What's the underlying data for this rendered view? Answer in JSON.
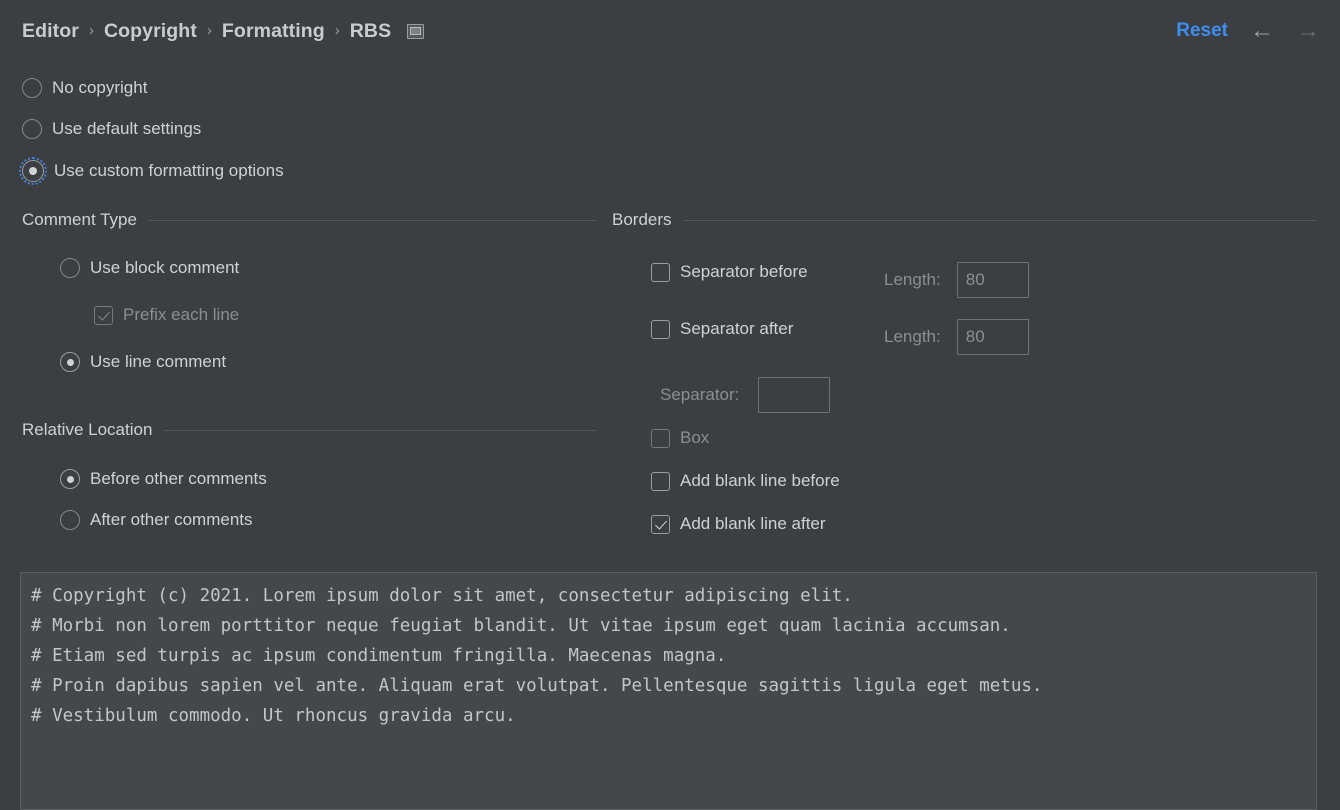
{
  "header": {
    "breadcrumb": [
      "Editor",
      "Copyright",
      "Formatting",
      "RBS"
    ],
    "separator": "›",
    "module_icon": "module-icon",
    "reset_label": "Reset",
    "back_arrow": "←",
    "forward_arrow": "→"
  },
  "top_options": [
    {
      "label": "No copyright",
      "selected": false
    },
    {
      "label": "Use default settings",
      "selected": false
    },
    {
      "label": "Use custom formatting options",
      "selected": true
    }
  ],
  "comment_type": {
    "title": "Comment Type",
    "options": [
      {
        "label": "Use block comment",
        "selected": false
      },
      {
        "label": "Use line comment",
        "selected": true
      }
    ],
    "prefix_each_line": {
      "label": "Prefix each line",
      "checked": true,
      "enabled": false
    }
  },
  "relative_location": {
    "title": "Relative Location",
    "options": [
      {
        "label": "Before other comments",
        "selected": true
      },
      {
        "label": "After other comments",
        "selected": false
      }
    ]
  },
  "borders": {
    "title": "Borders",
    "separator_before": {
      "label": "Separator before",
      "checked": false
    },
    "separator_before_length": {
      "label": "Length:",
      "value": "80"
    },
    "separator_after": {
      "label": "Separator after",
      "checked": false
    },
    "separator_after_length": {
      "label": "Length:",
      "value": "80"
    },
    "separator_char": {
      "label": "Separator:",
      "value": ""
    },
    "box": {
      "label": "Box",
      "checked": false,
      "enabled": false
    },
    "add_blank_line_before": {
      "label": "Add blank line before",
      "checked": false
    },
    "add_blank_line_after": {
      "label": "Add blank line after",
      "checked": true
    }
  },
  "preview": {
    "text": "# Copyright (c) 2021. Lorem ipsum dolor sit amet, consectetur adipiscing elit.\n# Morbi non lorem porttitor neque feugiat blandit. Ut vitae ipsum eget quam lacinia accumsan.\n# Etiam sed turpis ac ipsum condimentum fringilla. Maecenas magna.\n# Proin dapibus sapien vel ante. Aliquam erat volutpat. Pellentesque sagittis ligula eget metus.\n# Vestibulum commodo. Ut rhoncus gravida arcu."
  },
  "colors": {
    "background": "#3c3f41",
    "accent": "#3f8cf3",
    "text": "#cfd2d4",
    "text_dim": "#8b8e91",
    "preview_bg": "#44484b"
  }
}
